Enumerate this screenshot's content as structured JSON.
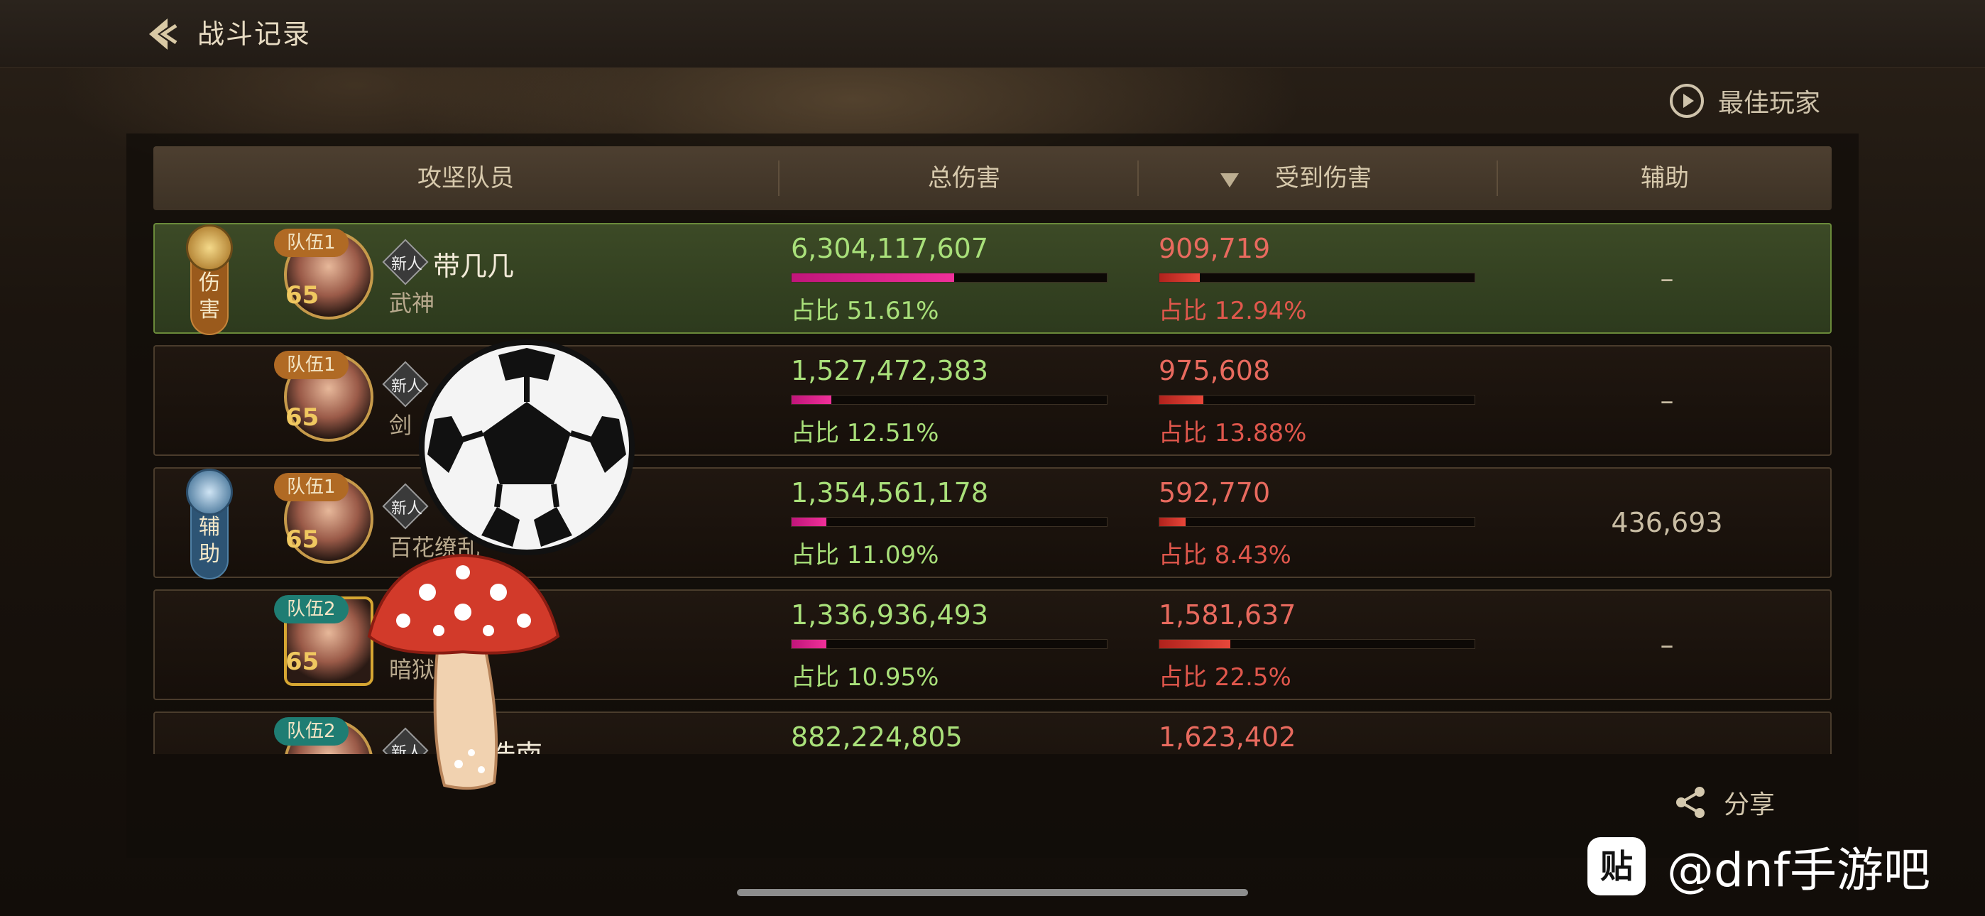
{
  "header": {
    "title": "战斗记录",
    "best_player_label": "最佳玩家"
  },
  "table": {
    "columns": [
      "攻坚队员",
      "总伤害",
      "受到伤害",
      "辅助"
    ],
    "rows": [
      {
        "team": "队伍1",
        "level": "65",
        "new_badge": "新人",
        "name": "带几几",
        "class": "武神",
        "role": [
          "伤",
          "害"
        ],
        "damage": "6,304,117,607",
        "damage_pct_label": "占比 51.61%",
        "damage_fill": 0.5161,
        "taken": "909,719",
        "taken_pct_label": "占比 12.94%",
        "taken_fill": 0.1294,
        "assist": "–"
      },
      {
        "team": "队伍1",
        "level": "65",
        "new_badge": "新人",
        "name": "",
        "class": "剑",
        "role": null,
        "damage": "1,527,472,383",
        "damage_pct_label": "占比 12.51%",
        "damage_fill": 0.1251,
        "taken": "975,608",
        "taken_pct_label": "占比 13.88%",
        "taken_fill": 0.1388,
        "assist": "–"
      },
      {
        "team": "队伍1",
        "level": "65",
        "new_badge": "新人",
        "name": "",
        "class": "百花缭乱",
        "role": [
          "辅",
          "助"
        ],
        "damage": "1,354,561,178",
        "damage_pct_label": "占比 11.09%",
        "damage_fill": 0.1109,
        "taken": "592,770",
        "taken_pct_label": "占比 8.43%",
        "taken_fill": 0.0843,
        "assist": "436,693"
      },
      {
        "team": "队伍2",
        "level": "65",
        "new_badge": "",
        "name": "",
        "class": "暗狱",
        "role": null,
        "damage": "1,336,936,493",
        "damage_pct_label": "占比 10.95%",
        "damage_fill": 0.1095,
        "taken": "1,581,637",
        "taken_pct_label": "占比 22.5%",
        "taken_fill": 0.225,
        "assist": "–"
      },
      {
        "team": "队伍2",
        "level": "",
        "new_badge": "新人",
        "name": "浩南",
        "class": "",
        "role": null,
        "damage": "882,224,805",
        "damage_pct_label": "",
        "damage_fill": 0,
        "taken": "1,623,402",
        "taken_pct_label": "",
        "taken_fill": 0,
        "assist": ""
      }
    ]
  },
  "footer": {
    "share_label": "分享"
  },
  "watermark": {
    "logo": "贴",
    "text": "@dnf手游吧"
  },
  "colors": {
    "damage": "#a9e07a",
    "taken": "#e86a5e",
    "highlight_row": "#3c4a26"
  }
}
